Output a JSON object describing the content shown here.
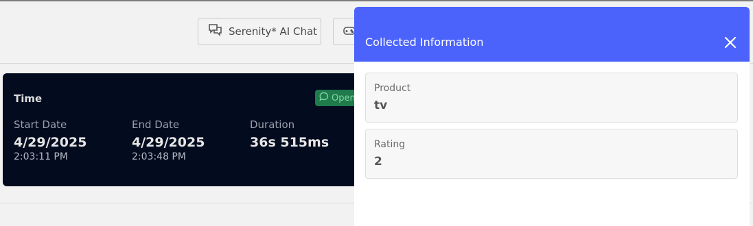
{
  "header": {
    "chat_button_label": "Serenity* AI Chat"
  },
  "time_card": {
    "title": "Time",
    "badge": "Open",
    "start": {
      "label": "Start Date",
      "date": "4/29/2025",
      "time": "2:03:11 PM"
    },
    "end": {
      "label": "End Date",
      "date": "4/29/2025",
      "time": "2:03:48 PM"
    },
    "duration": {
      "label": "Duration",
      "value": "36s 515ms"
    }
  },
  "panel": {
    "title": "Collected Information",
    "fields": [
      {
        "label": "Product",
        "value": "tv"
      },
      {
        "label": "Rating",
        "value": "2"
      }
    ]
  },
  "colors": {
    "panel_header": "#4b63fb",
    "time_card_bg": "#030b1f",
    "badge_bg": "#1f7a4c"
  }
}
